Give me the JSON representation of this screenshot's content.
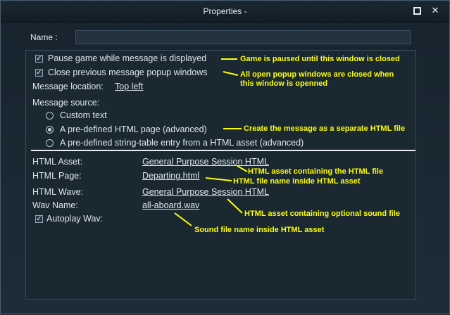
{
  "window": {
    "title": "Properties -",
    "maximize_icon": "maximize-icon",
    "close_icon": "close-icon"
  },
  "name_field": {
    "label": "Name :",
    "value": ""
  },
  "options": {
    "pause_game": {
      "label": "Pause game while message is displayed",
      "checked": true
    },
    "close_previous": {
      "label": "Close previous message popup windows",
      "checked": true
    },
    "location": {
      "label": "Message location:",
      "value": "Top left"
    }
  },
  "source": {
    "label": "Message source:",
    "items": [
      {
        "label": "Custom text",
        "selected": false
      },
      {
        "label": "A pre-defined HTML page (advanced)",
        "selected": true
      },
      {
        "label": "A pre-defined string-table entry from a HTML asset (advanced)",
        "selected": false
      }
    ]
  },
  "html": {
    "asset_label": "HTML Asset:",
    "asset_value": "General Purpose Session HTML",
    "page_label": "HTML Page:",
    "page_value": "Departing.html",
    "wave_label": "HTML Wave:",
    "wave_value": "General Purpose Session HTML",
    "wav_label": "Wav Name:",
    "wav_value": "all-aboard.wav",
    "autoplay_label": "Autoplay Wav:",
    "autoplay_checked": true
  },
  "annotations": {
    "pause": "Game is paused until this window is closed",
    "close_1": "All open popup windows are closed when",
    "close_2": "this window is openned",
    "html_page": "Create the message as a separate HTML file",
    "asset": "HTML asset containing the HTML file",
    "page": "HTML file name inside HTML asset",
    "wave": "HTML asset containing optional sound file",
    "wav": "Sound file name inside HTML asset",
    "color": "#ffff00"
  }
}
